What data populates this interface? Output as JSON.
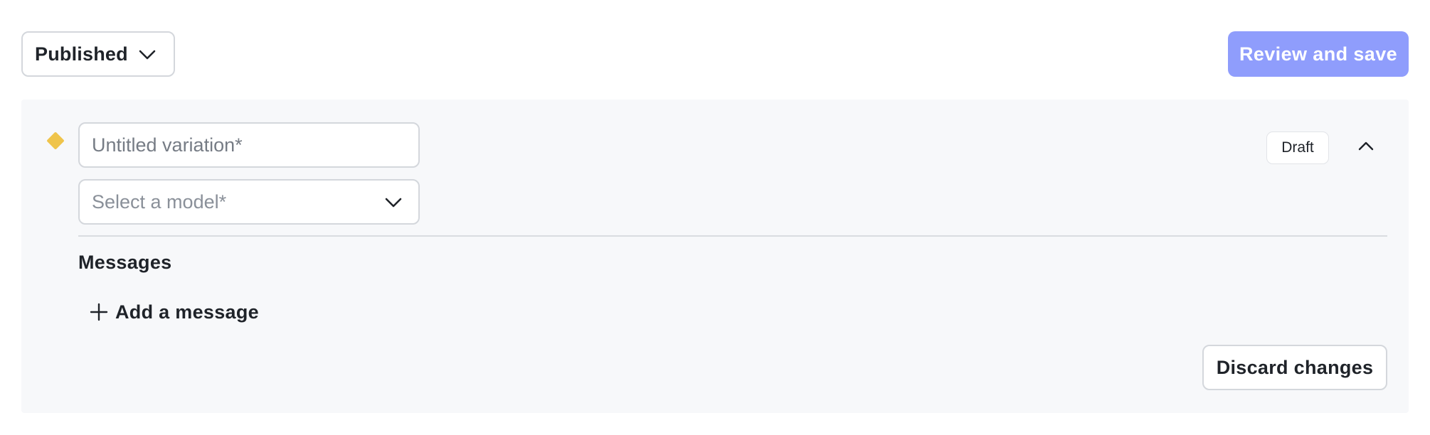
{
  "toolbar": {
    "status_value": "Published",
    "review_label": "Review and save"
  },
  "variation": {
    "name_value": "",
    "name_placeholder": "Untitled variation*",
    "model_placeholder": "Select a model*",
    "status_badge": "Draft",
    "messages_heading": "Messages",
    "add_message_label": "Add a message",
    "discard_label": "Discard changes"
  },
  "icons": {
    "status_chevron": "chevron-down-icon",
    "model_chevron": "chevron-down-icon",
    "collapse": "chevron-up-icon",
    "add": "plus-icon",
    "marker": "diamond-icon"
  },
  "colors": {
    "primary_button": "#8f9dfc",
    "marker": "#efc44b",
    "panel_background": "#f7f8fa"
  }
}
